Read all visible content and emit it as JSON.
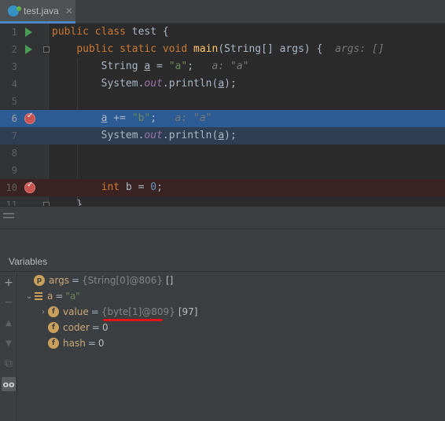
{
  "tab": {
    "filename": "test.java",
    "close": "✕"
  },
  "editor": {
    "lines": [
      {
        "num": "1",
        "parts": [
          [
            "kw",
            "public "
          ],
          [
            "kw",
            "class "
          ],
          [
            "plain",
            "test {"
          ]
        ]
      },
      {
        "num": "2",
        "parts": [
          [
            "plain",
            "    "
          ],
          [
            "kw",
            "public static void "
          ],
          [
            "fn",
            "main"
          ],
          [
            "plain",
            "(String[] args) {  "
          ],
          [
            "hint",
            "args: []"
          ]
        ]
      },
      {
        "num": "3",
        "parts": [
          [
            "plain",
            "        String "
          ],
          [
            "u",
            "a"
          ],
          [
            "plain",
            " = "
          ],
          [
            "str",
            "\"a\""
          ],
          [
            "plain",
            ";   "
          ],
          [
            "hint",
            "a: \"a\""
          ]
        ]
      },
      {
        "num": "4",
        "parts": [
          [
            "plain",
            "        System."
          ],
          [
            "fld",
            "out"
          ],
          [
            "plain",
            ".println("
          ],
          [
            "u",
            "a"
          ],
          [
            "plain",
            ");"
          ]
        ]
      },
      {
        "num": "5",
        "parts": []
      },
      {
        "num": "6",
        "parts": [
          [
            "plain",
            "        "
          ],
          [
            "u",
            "a"
          ],
          [
            "plain",
            " += "
          ],
          [
            "str",
            "\"b\""
          ],
          [
            "plain",
            ";   "
          ],
          [
            "hint",
            "a: \"a\""
          ]
        ]
      },
      {
        "num": "7",
        "parts": [
          [
            "plain",
            "        System."
          ],
          [
            "fld",
            "out"
          ],
          [
            "plain",
            ".println("
          ],
          [
            "u",
            "a"
          ],
          [
            "plain",
            ");"
          ]
        ]
      },
      {
        "num": "8",
        "parts": []
      },
      {
        "num": "9",
        "parts": []
      },
      {
        "num": "10",
        "parts": [
          [
            "plain",
            "        "
          ],
          [
            "kw",
            "int "
          ],
          [
            "plain",
            "b = "
          ],
          [
            "num",
            "0"
          ],
          [
            "plain",
            ";"
          ]
        ]
      },
      {
        "num": "11",
        "parts": [
          [
            "plain",
            "    }"
          ]
        ]
      }
    ]
  },
  "variables": {
    "title": "Variables",
    "items": [
      {
        "badge": "p",
        "name": "args",
        "ref": "{String[0]@806}",
        "value": "[]"
      },
      {
        "badge": "=",
        "name": "a",
        "ref": "",
        "value": "\"a\""
      },
      {
        "badge": "f",
        "name": "value",
        "ref": "{byte[1]@809}",
        "value": "[97]"
      },
      {
        "badge": "f",
        "name": "coder",
        "ref": "",
        "value": "0"
      },
      {
        "badge": "f",
        "name": "hash",
        "ref": "",
        "value": "0"
      }
    ]
  },
  "toolbar": {
    "add": "+",
    "remove": "−",
    "up": "▲",
    "down": "▼",
    "copy": "⧉",
    "watch": "oo"
  }
}
